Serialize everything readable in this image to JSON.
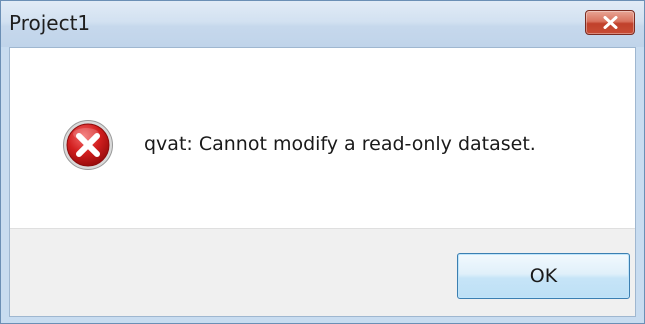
{
  "window": {
    "title": "Project1"
  },
  "dialog": {
    "icon": "error-icon",
    "message": "qvat: Cannot modify a read-only dataset.",
    "ok_label": "OK"
  },
  "colors": {
    "close_button": "#c84d36",
    "error_icon": "#c4141b",
    "ok_button_border": "#3c7fb1"
  }
}
